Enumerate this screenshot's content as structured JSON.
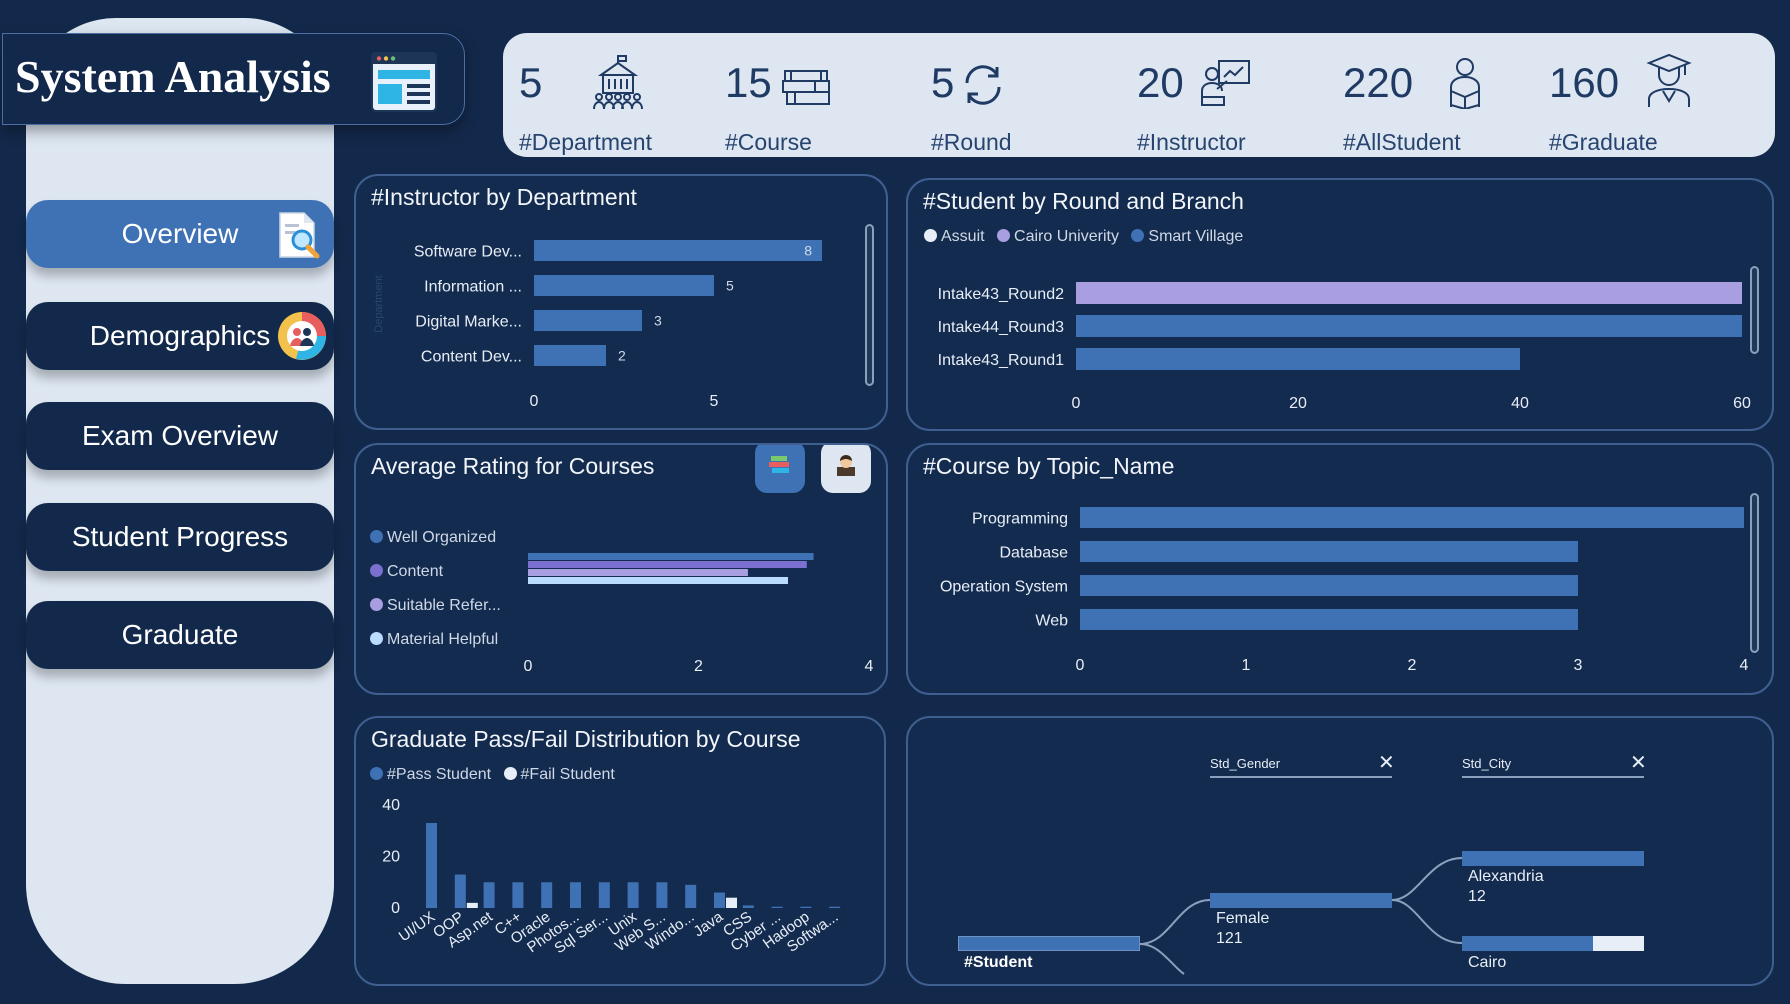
{
  "app": {
    "title": "System Analysis"
  },
  "nav": {
    "items": [
      {
        "label": "Overview",
        "active": true,
        "icon": "magnifier-document-icon"
      },
      {
        "label": "Demographics",
        "active": false,
        "icon": "people-chart-icon"
      },
      {
        "label": "Exam Overview",
        "active": false,
        "icon": ""
      },
      {
        "label": "Student Progress",
        "active": false,
        "icon": ""
      },
      {
        "label": "Graduate",
        "active": false,
        "icon": ""
      }
    ]
  },
  "kpis": [
    {
      "value": "5",
      "label": "#Department",
      "icon": "building-icon"
    },
    {
      "value": "15",
      "label": "#Course",
      "icon": "books-icon"
    },
    {
      "value": "5",
      "label": "#Round",
      "icon": "refresh-cycle-icon"
    },
    {
      "value": "20",
      "label": "#Instructor",
      "icon": "teacher-board-icon"
    },
    {
      "value": "220",
      "label": "#AllStudent",
      "icon": "student-reading-icon"
    },
    {
      "value": "160",
      "label": "#Graduate",
      "icon": "graduate-cap-icon"
    }
  ],
  "colors": {
    "background": "#13294b",
    "panel_light": "#dde6f1",
    "accent_blue": "#3f72b5",
    "lavender": "#a99fe0",
    "light_blue": "#b9dcff",
    "white_series": "#e8eef7"
  },
  "chart_data": [
    {
      "id": "instructor_by_department",
      "type": "bar",
      "orientation": "horizontal",
      "title": "#Instructor by Department",
      "ylabel": "Department",
      "categories": [
        "Software Dev...",
        "Information ...",
        "Digital Marke...",
        "Content Dev..."
      ],
      "values": [
        8,
        5,
        3,
        2
      ],
      "xticks": [
        0,
        5
      ],
      "xlim": [
        0,
        8.5
      ],
      "data_labels": true
    },
    {
      "id": "student_by_round_branch",
      "type": "bar",
      "orientation": "horizontal",
      "title": "#Student by Round and Branch",
      "legend": [
        "Assuit",
        "Cairo Univerity",
        "Smart Village"
      ],
      "legend_colors": [
        "#e8eef7",
        "#a99fe0",
        "#3f72b5"
      ],
      "categories": [
        "Intake43_Round2",
        "Intake44_Round3",
        "Intake43_Round1"
      ],
      "values": [
        60,
        60,
        40
      ],
      "bar_colors": [
        "#a99fe0",
        "#3f72b5",
        "#3f72b5"
      ],
      "xticks": [
        0,
        20,
        40,
        60
      ],
      "xlim": [
        0,
        60
      ]
    },
    {
      "id": "average_rating_courses",
      "type": "bar",
      "orientation": "horizontal",
      "title": "Average Rating for Courses",
      "legend": [
        "Well Organized",
        "Content",
        "Suitable Refer...",
        "Material Helpful"
      ],
      "series": [
        {
          "name": "Well Organized",
          "values": [
            3.35
          ],
          "color": "#3f72b5"
        },
        {
          "name": "Content",
          "values": [
            3.27
          ],
          "color": "#7b6fd0"
        },
        {
          "name": "Suitable Refer...",
          "values": [
            2.58
          ],
          "color": "#a99fe0"
        },
        {
          "name": "Material Helpful",
          "values": [
            3.05
          ],
          "color": "#b9dcff"
        }
      ],
      "xticks": [
        0,
        2,
        4
      ],
      "xlim": [
        0,
        4
      ]
    },
    {
      "id": "course_by_topic",
      "type": "bar",
      "orientation": "horizontal",
      "title": "#Course by Topic_Name",
      "categories": [
        "Programming",
        "Database",
        "Operation System",
        "Web"
      ],
      "values": [
        4,
        3,
        3,
        3
      ],
      "xticks": [
        0,
        1,
        2,
        3,
        4
      ],
      "xlim": [
        0,
        4
      ]
    },
    {
      "id": "graduate_pass_fail",
      "type": "bar",
      "orientation": "vertical",
      "title": "Graduate Pass/Fail Distribution by Course",
      "legend": [
        "#Pass Student",
        "#Fail Student"
      ],
      "categories": [
        "UI/UX",
        "OOP",
        "Asp.net",
        "C++",
        "Oracle",
        "Photos...",
        "Sql Ser...",
        "Unix",
        "Web S...",
        "Windo...",
        "Java",
        "CSS",
        "Cyber ...",
        "Hadoop",
        "Softwa..."
      ],
      "series": [
        {
          "name": "#Pass Student",
          "values": [
            33,
            13,
            10,
            10,
            10,
            10,
            10,
            10,
            10,
            9,
            6,
            1,
            0.5,
            0.5,
            0.5
          ],
          "color": "#3f72b5"
        },
        {
          "name": "#Fail Student",
          "values": [
            0,
            2,
            0,
            0,
            0,
            0,
            0,
            0,
            0,
            0,
            4,
            0,
            0,
            0,
            0
          ],
          "color": "#e8eef7"
        }
      ],
      "yticks": [
        0,
        20,
        40
      ],
      "ylim": [
        0,
        40
      ]
    }
  ],
  "decomposition": {
    "root_label": "#Student",
    "level1_title": "Std_Gender",
    "level2_title": "Std_City",
    "gender_node": {
      "name": "Female",
      "value": "121"
    },
    "city_nodes": [
      {
        "name": "Alexandria",
        "value": "12"
      },
      {
        "name": "Cairo",
        "value": ""
      }
    ],
    "close_symbol": "✕"
  }
}
